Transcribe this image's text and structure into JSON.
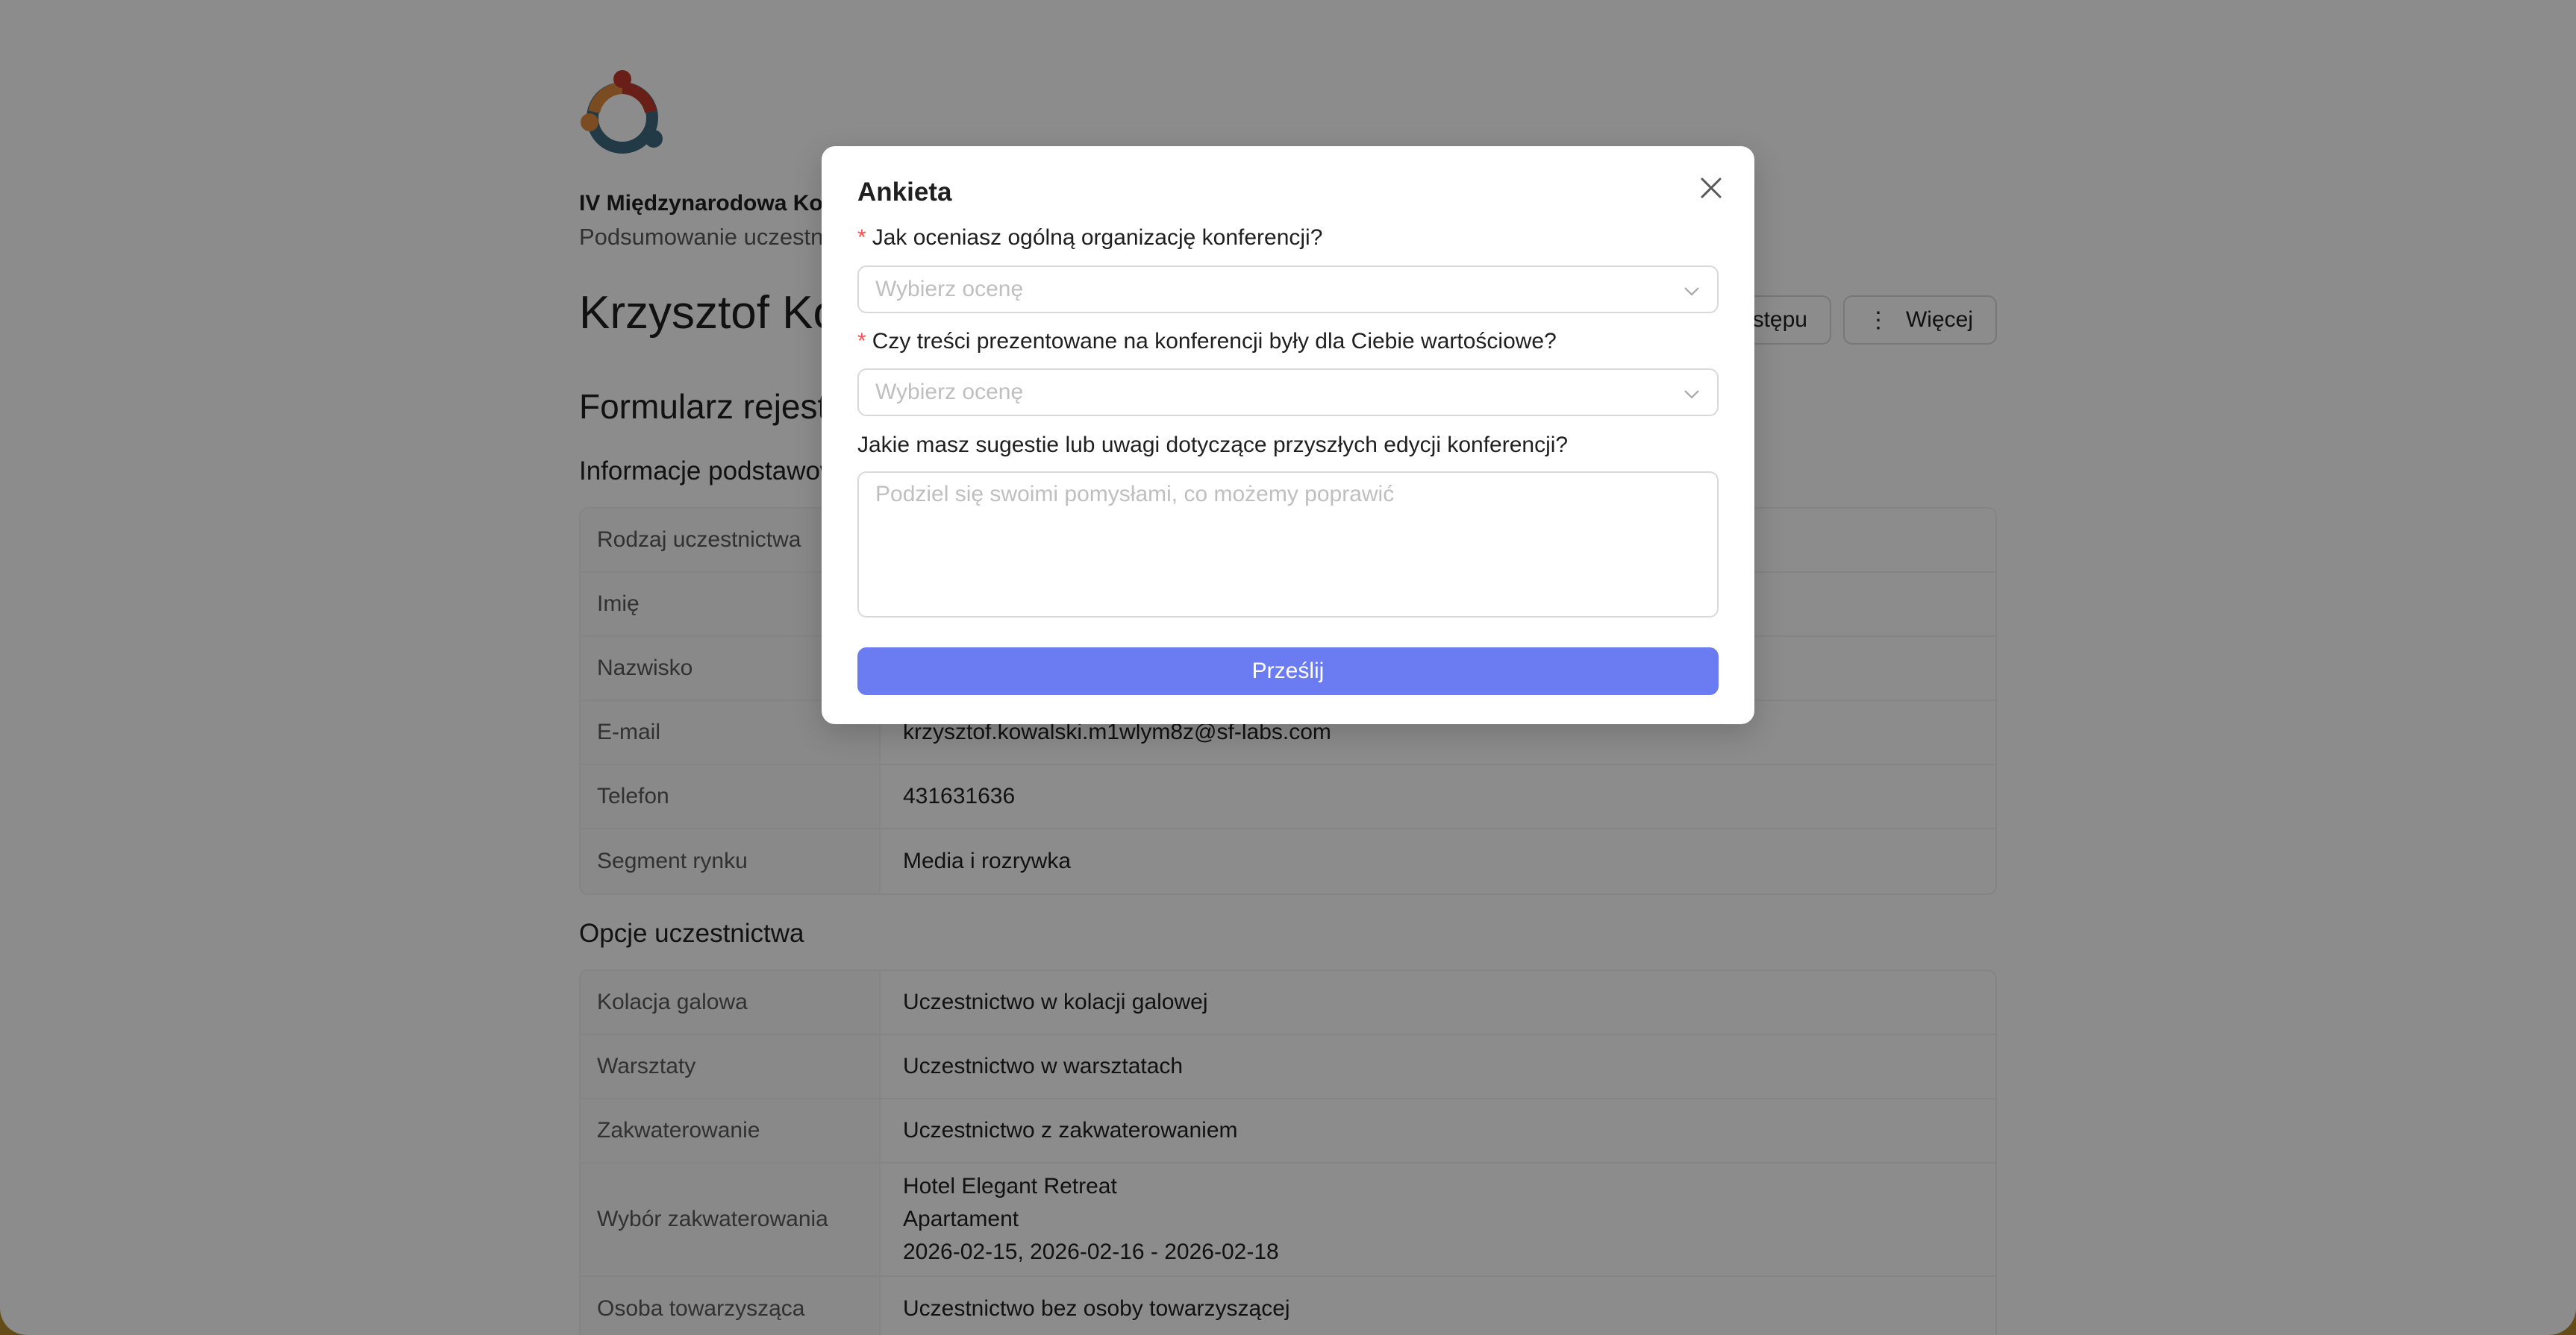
{
  "header": {
    "org_title": "IV Międzynarodowa Konferencja",
    "org_subtitle": "Podsumowanie uczestnictwa",
    "person_name": "Krzysztof Kowalski"
  },
  "actions": {
    "certificate_label": "Potwierdzenie wstępu",
    "more_label": "Więcej",
    "more_icon": "more-vertical-icon"
  },
  "form": {
    "title": "Formularz rejestracyjny"
  },
  "basic_info": {
    "heading": "Informacje podstawowe",
    "rows": [
      {
        "label": "Rodzaj uczestnictwa",
        "value": ""
      },
      {
        "label": "Imię",
        "value": ""
      },
      {
        "label": "Nazwisko",
        "value": ""
      },
      {
        "label": "E-mail",
        "value": "krzysztof.kowalski.m1wlym8z@sf-labs.com"
      },
      {
        "label": "Telefon",
        "value": "431631636"
      },
      {
        "label": "Segment rynku",
        "value": "Media i rozrywka"
      }
    ]
  },
  "participation": {
    "heading": "Opcje uczestnictwa",
    "rows": [
      {
        "label": "Kolacja galowa",
        "value": "Uczestnictwo w kolacji galowej"
      },
      {
        "label": "Warsztaty",
        "value": "Uczestnictwo w warsztatach"
      },
      {
        "label": "Zakwaterowanie",
        "value": "Uczestnictwo z zakwaterowaniem"
      },
      {
        "label": "Wybór zakwaterowania",
        "lines": [
          "Hotel Elegant Retreat",
          "Apartament",
          "2026-02-15, 2026-02-16 - 2026-02-18"
        ]
      },
      {
        "label": "Osoba towarzysząca",
        "value": "Uczestnictwo bez osoby towarzyszącej"
      }
    ]
  },
  "modal": {
    "title": "Ankieta",
    "close_icon": "close-icon",
    "q1": {
      "required_mark": "*",
      "label": "Jak oceniasz ogólną organizację konferencji?",
      "placeholder": "Wybierz ocenę"
    },
    "q2": {
      "required_mark": "*",
      "label": "Czy treści prezentowane na konferencji były dla Ciebie wartościowe?",
      "placeholder": "Wybierz ocenę"
    },
    "q3": {
      "label": "Jakie masz sugestie lub uwagi dotyczące przyszłych edycji konferencji?",
      "placeholder": "Podziel się swoimi pomysłami, co możemy poprawić"
    },
    "submit_label": "Prześlij"
  },
  "colors": {
    "accent": "#6b7cf2",
    "required": "#ff4d4f",
    "overlay": "rgba(0,0,0,0.45)",
    "bottom_edge": "#b48a2a"
  }
}
